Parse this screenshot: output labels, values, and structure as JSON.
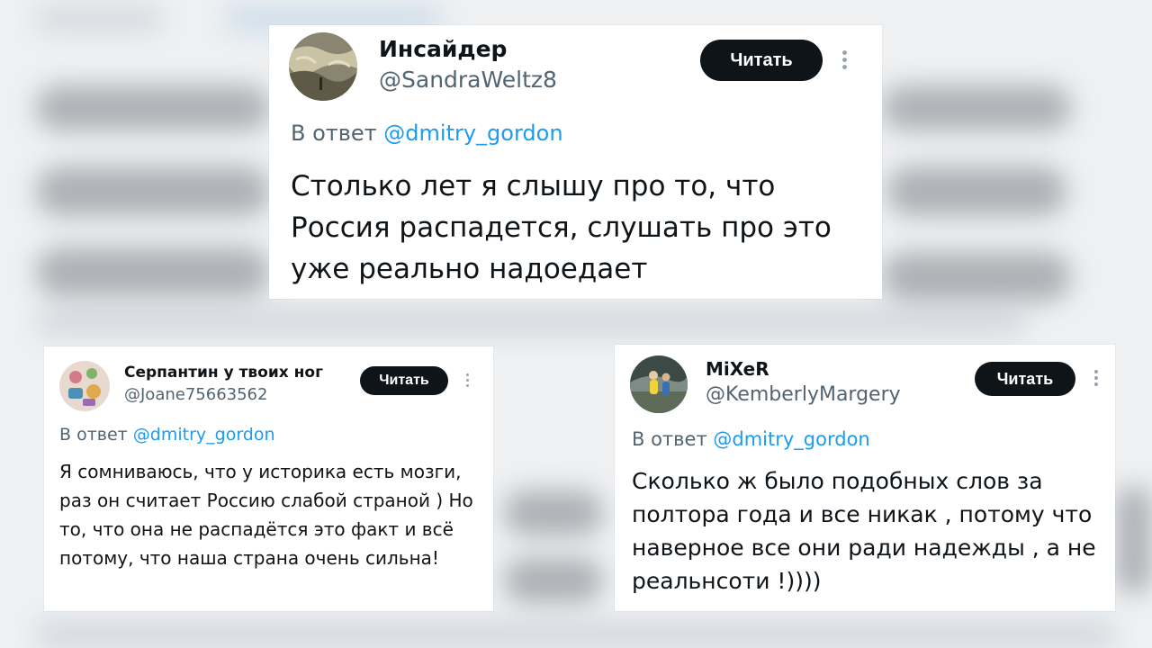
{
  "colors": {
    "background": "#e9ecef",
    "card": "#ffffff",
    "name": "#0f1419",
    "handle": "#536471",
    "link": "#1d9bf0",
    "follow_button": "#0f1419",
    "follow_text": "#ffffff"
  },
  "posts": [
    {
      "name": "Инсайдер",
      "handle": "@SandraWeltz8",
      "follow_label": "Читать",
      "reply_prefix": "В ответ",
      "reply_to": "@dmitry_gordon",
      "text": "Столько лет я слышу про то, что Россия распадется, слушать про это уже реально надоедает",
      "avatar_icon": "avatar-landscape-icon"
    },
    {
      "name": "Серпантин у твоих ног",
      "handle": "@Joane75663562",
      "follow_label": "Читать",
      "reply_prefix": "В ответ",
      "reply_to": "@dmitry_gordon",
      "text": "Я сомниваюсь, что у историка есть мозги, раз он считает Россию слабой страной ) Но то, что она не распадётся это факт и всё потому, что наша страна очень сильна!",
      "avatar_icon": "avatar-objects-icon"
    },
    {
      "name": "MiXeR",
      "handle": "@KemberlyMargery",
      "follow_label": "Читать",
      "reply_prefix": "В ответ",
      "reply_to": "@dmitry_gordon",
      "text": "Сколько ж было подобных слов за полтора года и все никак , потому что наверное все они ради надежды , а не реальнсоти !))))",
      "avatar_icon": "avatar-people-icon"
    }
  ]
}
